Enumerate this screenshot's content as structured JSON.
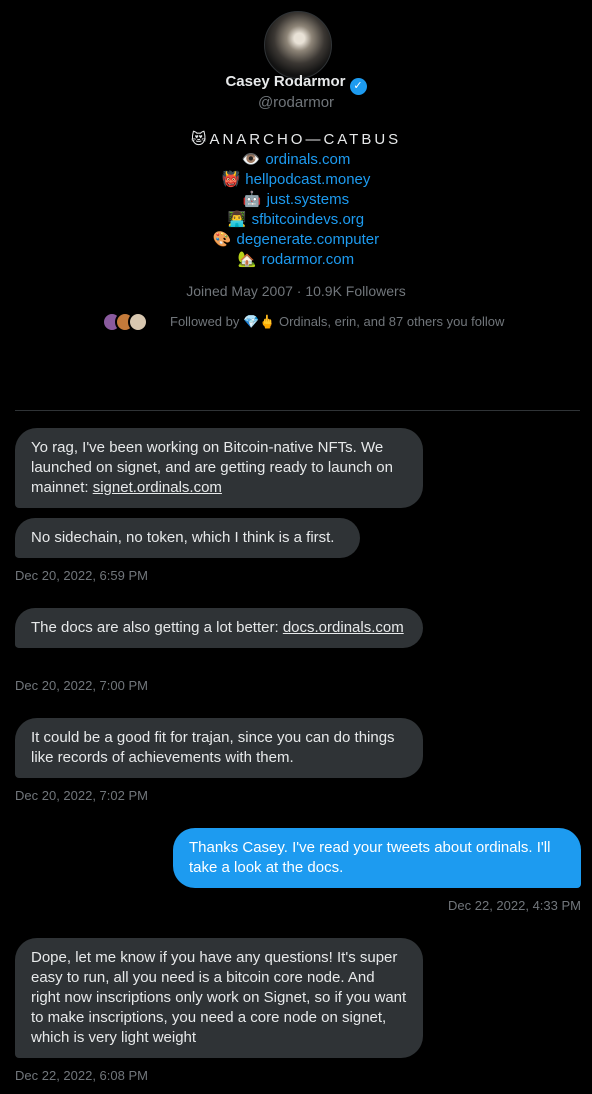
{
  "profile": {
    "name": "Casey Rodarmor",
    "verified_glyph": "✓",
    "handle": "@rodarmor",
    "bio_title": "😻ANARCHO—CATBUS",
    "bio_links": [
      {
        "emoji": "👁️",
        "text": "ordinals.com"
      },
      {
        "emoji": "👹",
        "text": "hellpodcast.money"
      },
      {
        "emoji": "🤖",
        "text": "just.systems"
      },
      {
        "emoji": "👨‍💻",
        "text": "sfbitcoindevs.org"
      },
      {
        "emoji": "🎨",
        "text": "degenerate.computer"
      },
      {
        "emoji": "🏡",
        "text": "rodarmor.com"
      }
    ],
    "joined": "Joined May 2007 · 10.9K Followers",
    "followed_by": "Followed by 💎🖕 Ordinals, erin, and 87 others you follow"
  },
  "messages": [
    {
      "text_before": "Yo rag, I've been working on Bitcoin-native NFTs. We launched on signet, and are getting ready to launch on mainnet: ",
      "link": "signet.ordinals.com",
      "text_after": ""
    },
    {
      "text": "No sidechain, no token, which I think is a first.",
      "timestamp": "Dec 20, 2022, 6:59 PM"
    },
    {
      "text_before": "The docs are also getting a lot better: ",
      "link": "docs.ordinals.com",
      "timestamp": "Dec 20, 2022, 7:00 PM"
    },
    {
      "text": "It could be a good fit for trajan, since you can do things like records of achievements with them.",
      "timestamp": "Dec 20, 2022, 7:02 PM"
    },
    {
      "text": "Thanks Casey. I've read your tweets about ordinals. I'll take a look at the docs.",
      "timestamp": "Dec 22, 2022, 4:33 PM"
    },
    {
      "text": "Dope, let me know if you have any questions! It's super easy to run, all you need is a bitcoin core node. And right now inscriptions only work on Signet, so if you want to make inscriptions, you need a core node on signet, which is very light weight",
      "timestamp": "Dec 22, 2022, 6:08 PM"
    }
  ],
  "colors": {
    "background": "#000000",
    "accent": "#1d9bf0",
    "received_bubble": "#2f3336",
    "muted": "#71767b"
  }
}
